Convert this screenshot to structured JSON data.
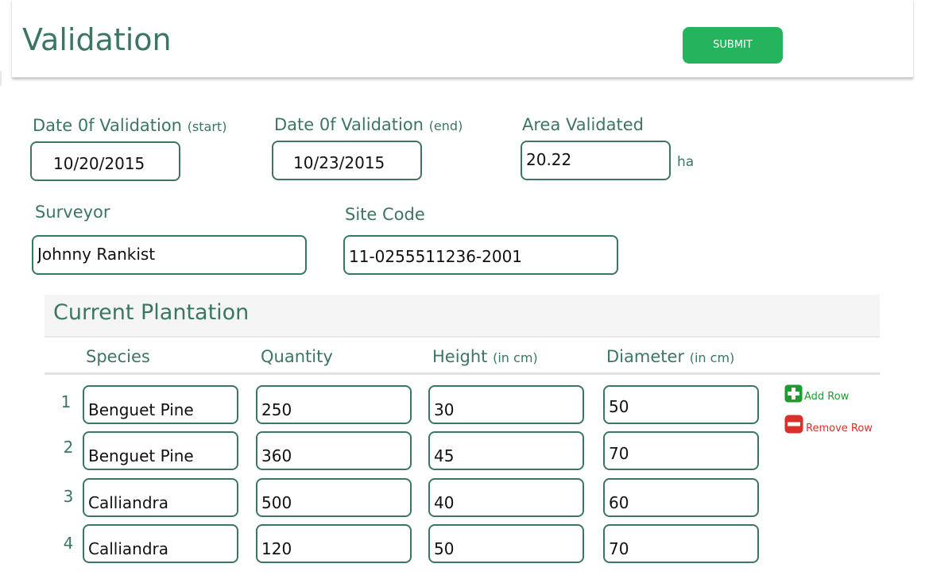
{
  "header": {
    "title": "Validation",
    "submit_label": "SUBMIT"
  },
  "form": {
    "date_start": {
      "label": "Date 0f Validation",
      "sub_label": "(start)",
      "value": "10/20/2015"
    },
    "date_end": {
      "label": "Date 0f Validation",
      "sub_label": "(end)",
      "value": "10/23/2015"
    },
    "area": {
      "label": "Area Validated",
      "value": "20.22",
      "unit": "ha"
    },
    "surveyor": {
      "label": "Surveyor",
      "value": "Johnny Rankist"
    },
    "site_code": {
      "label": "Site Code",
      "value": "11-0255511236-2001"
    }
  },
  "plantation": {
    "title": "Current Plantation",
    "columns": {
      "species": "Species",
      "quantity": "Quantity",
      "height": "Height",
      "height_unit": "(in cm)",
      "diameter": "Diameter",
      "diameter_unit": "(in cm)"
    },
    "rows": [
      {
        "num": "1",
        "species": "Benguet Pine",
        "quantity": "250",
        "height": "30",
        "diameter": "50"
      },
      {
        "num": "2",
        "species": "Benguet Pine",
        "quantity": "360",
        "height": "45",
        "diameter": "70"
      },
      {
        "num": "3",
        "species": "Calliandra",
        "quantity": "500",
        "height": "40",
        "diameter": "60"
      },
      {
        "num": "4",
        "species": "Calliandra",
        "quantity": "120",
        "height": "50",
        "diameter": "70"
      }
    ],
    "add_row_label": "Add Row",
    "remove_row_label": "Remove Row"
  },
  "colors": {
    "primary_text": "#3b7760",
    "submit_bg": "#26b35e",
    "add_green": "#1e9a2f",
    "remove_red": "#d9302c"
  },
  "icons": {
    "add": "plus-square-icon",
    "remove": "minus-square-icon"
  }
}
